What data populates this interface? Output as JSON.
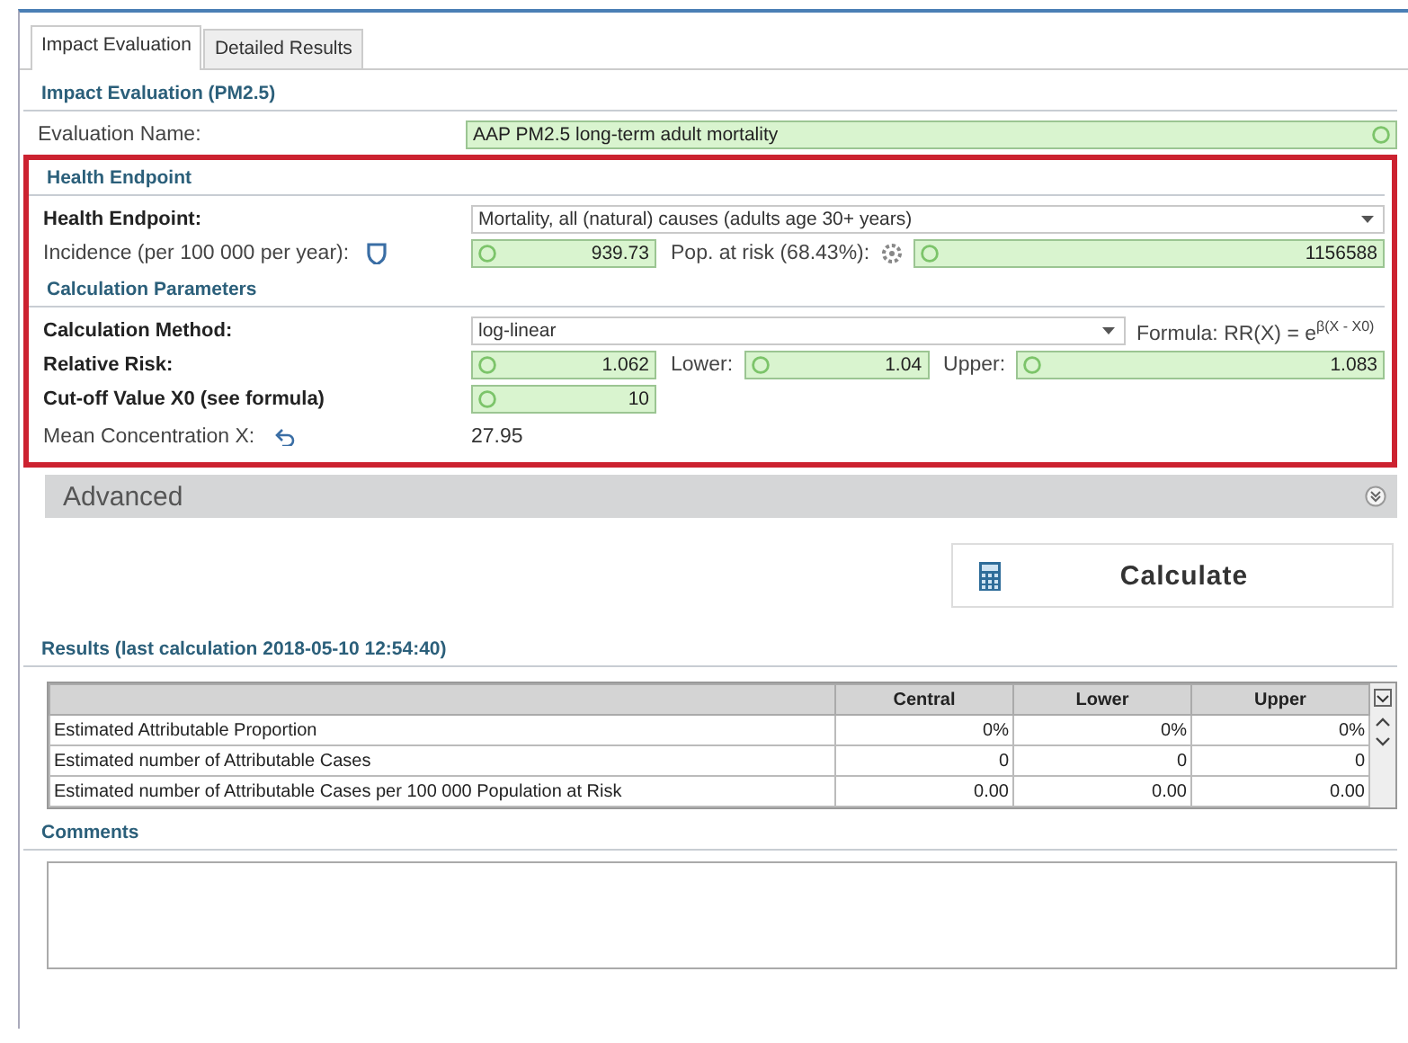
{
  "tabs": [
    {
      "label": "Impact Evaluation",
      "selected": true
    },
    {
      "label": "Detailed Results",
      "selected": false
    }
  ],
  "evaluation": {
    "heading": "Impact Evaluation (PM2.5)",
    "name_label": "Evaluation Name:",
    "name_value": "AAP PM2.5 long-term adult mortality"
  },
  "health_endpoint": {
    "heading": "Health Endpoint",
    "endpoint_label": "Health Endpoint:",
    "endpoint_value": "Mortality, all (natural) causes (adults age 30+ years)",
    "incidence_label": "Incidence (per 100 000 per year):",
    "incidence_value": "939.73",
    "pop_label": "Pop. at risk (68.43%):",
    "pop_value": "1156588"
  },
  "calculation_parameters": {
    "heading": "Calculation Parameters",
    "method_label": "Calculation Method:",
    "method_value": "log-linear",
    "formula": "Formula: RR(X) = e$^{β(X - X0)}$",
    "rr_label": "Relative Risk:",
    "rr_value": "1.062",
    "lower_label": "Lower:",
    "lower_value": "1.04",
    "upper_label": "Upper:",
    "upper_value": "1.083",
    "cutoff_label": "Cut-off Value X0 (see formula)",
    "cutoff_value": "10",
    "mean_label": "Mean Concentration X:",
    "mean_value": "27.95"
  },
  "advanced": {
    "title": "Advanced",
    "expanded": false
  },
  "calculate_button": "Calculate",
  "results": {
    "heading": "Results (last calculation 2018-05-10 12:54:40)",
    "columns": [
      "Central",
      "Lower",
      "Upper"
    ],
    "rows": [
      {
        "label": "Estimated Attributable Proportion",
        "values": [
          "0%",
          "0%",
          "0%"
        ]
      },
      {
        "label": "Estimated number of Attributable Cases",
        "values": [
          "0",
          "0",
          "0"
        ]
      },
      {
        "label": "Estimated number of Attributable Cases per 100 000 Population at Risk",
        "values": [
          "0.00",
          "0.00",
          "0.00"
        ]
      }
    ]
  },
  "comments": {
    "heading": "Comments"
  }
}
